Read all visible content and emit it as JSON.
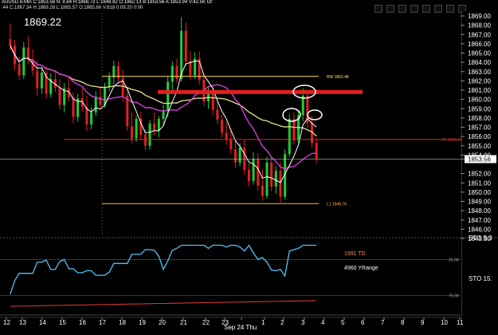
{
  "header": {
    "line1": "AUUSD 8-Min  C:1853.56  N: 8.84  H:1868.73  L:1848.82  O:1862.13  B:1853.56  A:1853.94  V:42.5K  OI:",
    "line2": ":44  C:1867.34  H:1869.28  L:1865.57  O:1865.66  V:618  0:09:20  0:00"
  },
  "current_price_big": "1869.22",
  "chart_data": {
    "type": "candlestick",
    "y_axis": {
      "min": 1845,
      "max": 1869,
      "ticks": [
        "1869.00",
        "1868.00",
        "1867.00",
        "1866.00",
        "1865.00",
        "1864.00",
        "1863.00",
        "1862.00",
        "1861.00",
        "1860.00",
        "1859.00",
        "1858.00",
        "1857.00",
        "1856.00",
        "1855.00",
        "1854.00",
        "1853.56",
        "1852.00",
        "1851.00",
        "1850.00",
        "1849.00",
        "1848.00",
        "1847.00",
        "1846.00",
        "1845.00"
      ]
    },
    "x_axis": {
      "ticks": [
        "12",
        "13",
        "14",
        "15",
        "16",
        "17",
        "18",
        "19",
        "20",
        "21",
        "22",
        "23",
        "Sep 24 Thu",
        "1",
        "2",
        "3",
        "4",
        "5",
        "6",
        "7",
        "8",
        "9",
        "10",
        "11"
      ]
    },
    "last_price_label": "1853.56",
    "horizontal_levels": [
      {
        "label": "RW 1862.48",
        "value": 1862.48,
        "color": "#ffe066"
      },
      {
        "label": "TL 1855.68",
        "value": 1855.68,
        "color": "#c0392b"
      },
      {
        "label": "L1 1848.76",
        "value": 1848.76,
        "color": "#ffb347"
      },
      {
        "label": "",
        "value": 1860.8,
        "color": "#e02020"
      },
      {
        "label": "",
        "value": 1853.56,
        "color": "#dddddd"
      }
    ],
    "candles": [
      {
        "o": 1866.5,
        "h": 1868.2,
        "l": 1865.3,
        "c": 1865.8
      },
      {
        "o": 1865.8,
        "h": 1866.4,
        "l": 1863.2,
        "c": 1863.8
      },
      {
        "o": 1863.8,
        "h": 1864.6,
        "l": 1862.1,
        "c": 1862.6
      },
      {
        "o": 1862.6,
        "h": 1866.2,
        "l": 1862.2,
        "c": 1865.6
      },
      {
        "o": 1865.6,
        "h": 1866.8,
        "l": 1863.8,
        "c": 1864.3
      },
      {
        "o": 1864.3,
        "h": 1865.4,
        "l": 1862.6,
        "c": 1863.1
      },
      {
        "o": 1863.1,
        "h": 1864.2,
        "l": 1860.4,
        "c": 1861.2
      },
      {
        "o": 1861.2,
        "h": 1863.4,
        "l": 1860.6,
        "c": 1862.9
      },
      {
        "o": 1862.9,
        "h": 1863.6,
        "l": 1860.1,
        "c": 1860.6
      },
      {
        "o": 1860.6,
        "h": 1862.8,
        "l": 1860.2,
        "c": 1862.2
      },
      {
        "o": 1862.2,
        "h": 1863.1,
        "l": 1860.8,
        "c": 1861.3
      },
      {
        "o": 1861.3,
        "h": 1862.2,
        "l": 1858.9,
        "c": 1859.4
      },
      {
        "o": 1859.4,
        "h": 1861.8,
        "l": 1858.6,
        "c": 1861.2
      },
      {
        "o": 1861.2,
        "h": 1862.4,
        "l": 1859.8,
        "c": 1860.2
      },
      {
        "o": 1860.2,
        "h": 1860.8,
        "l": 1857.4,
        "c": 1858.1
      },
      {
        "o": 1858.1,
        "h": 1860.6,
        "l": 1857.6,
        "c": 1860.1
      },
      {
        "o": 1860.1,
        "h": 1861.2,
        "l": 1858.7,
        "c": 1859.2
      },
      {
        "o": 1859.2,
        "h": 1860.4,
        "l": 1856.6,
        "c": 1857.3
      },
      {
        "o": 1857.3,
        "h": 1859.2,
        "l": 1856.8,
        "c": 1858.6
      },
      {
        "o": 1858.6,
        "h": 1860.9,
        "l": 1858.2,
        "c": 1860.3
      },
      {
        "o": 1860.3,
        "h": 1861.4,
        "l": 1858.9,
        "c": 1859.4
      },
      {
        "o": 1859.4,
        "h": 1861.8,
        "l": 1859.1,
        "c": 1861.3
      },
      {
        "o": 1861.3,
        "h": 1862.9,
        "l": 1860.9,
        "c": 1862.4
      },
      {
        "o": 1862.4,
        "h": 1864.2,
        "l": 1861.6,
        "c": 1863.6
      },
      {
        "o": 1863.6,
        "h": 1864.1,
        "l": 1861.8,
        "c": 1862.3
      },
      {
        "o": 1862.3,
        "h": 1863.2,
        "l": 1859.7,
        "c": 1860.4
      },
      {
        "o": 1860.4,
        "h": 1861.2,
        "l": 1856.6,
        "c": 1857.1
      },
      {
        "o": 1857.1,
        "h": 1858.6,
        "l": 1855.2,
        "c": 1855.8
      },
      {
        "o": 1855.8,
        "h": 1858.3,
        "l": 1855.4,
        "c": 1857.9
      },
      {
        "o": 1857.9,
        "h": 1858.7,
        "l": 1855.6,
        "c": 1856.2
      },
      {
        "o": 1856.2,
        "h": 1856.8,
        "l": 1854.5,
        "c": 1855.0
      },
      {
        "o": 1855.0,
        "h": 1857.8,
        "l": 1854.6,
        "c": 1857.4
      },
      {
        "o": 1857.4,
        "h": 1858.6,
        "l": 1856.1,
        "c": 1856.6
      },
      {
        "o": 1856.6,
        "h": 1858.2,
        "l": 1855.9,
        "c": 1857.9
      },
      {
        "o": 1857.9,
        "h": 1859.4,
        "l": 1857.2,
        "c": 1858.8
      },
      {
        "o": 1858.8,
        "h": 1862.5,
        "l": 1858.1,
        "c": 1861.9
      },
      {
        "o": 1861.9,
        "h": 1864.1,
        "l": 1860.6,
        "c": 1863.6
      },
      {
        "o": 1863.6,
        "h": 1864.4,
        "l": 1861.8,
        "c": 1862.2
      },
      {
        "o": 1862.2,
        "h": 1868.9,
        "l": 1861.9,
        "c": 1867.4
      },
      {
        "o": 1867.4,
        "h": 1868.3,
        "l": 1863.6,
        "c": 1864.1
      },
      {
        "o": 1864.1,
        "h": 1865.2,
        "l": 1862.1,
        "c": 1862.6
      },
      {
        "o": 1862.6,
        "h": 1865.1,
        "l": 1862.2,
        "c": 1864.4
      },
      {
        "o": 1864.4,
        "h": 1865.2,
        "l": 1861.6,
        "c": 1862.1
      },
      {
        "o": 1862.1,
        "h": 1862.7,
        "l": 1859.3,
        "c": 1859.8
      },
      {
        "o": 1859.8,
        "h": 1861.3,
        "l": 1859.0,
        "c": 1860.7
      },
      {
        "o": 1860.7,
        "h": 1861.4,
        "l": 1858.3,
        "c": 1858.9
      },
      {
        "o": 1858.9,
        "h": 1859.8,
        "l": 1857.4,
        "c": 1857.8
      },
      {
        "o": 1857.8,
        "h": 1858.4,
        "l": 1855.9,
        "c": 1856.4
      },
      {
        "o": 1856.4,
        "h": 1857.6,
        "l": 1855.1,
        "c": 1855.7
      },
      {
        "o": 1855.7,
        "h": 1856.9,
        "l": 1854.1,
        "c": 1854.6
      },
      {
        "o": 1854.6,
        "h": 1855.7,
        "l": 1852.6,
        "c": 1853.2
      },
      {
        "o": 1853.2,
        "h": 1855.3,
        "l": 1852.8,
        "c": 1854.8
      },
      {
        "o": 1854.8,
        "h": 1855.6,
        "l": 1851.9,
        "c": 1852.4
      },
      {
        "o": 1852.4,
        "h": 1853.1,
        "l": 1850.6,
        "c": 1851.2
      },
      {
        "o": 1851.2,
        "h": 1854.3,
        "l": 1850.8,
        "c": 1853.6
      },
      {
        "o": 1853.6,
        "h": 1854.2,
        "l": 1850.2,
        "c": 1850.7
      },
      {
        "o": 1850.7,
        "h": 1852.4,
        "l": 1849.1,
        "c": 1849.6
      },
      {
        "o": 1849.6,
        "h": 1853.8,
        "l": 1849.3,
        "c": 1853.2
      },
      {
        "o": 1853.2,
        "h": 1853.9,
        "l": 1850.1,
        "c": 1850.6
      },
      {
        "o": 1850.6,
        "h": 1852.8,
        "l": 1849.8,
        "c": 1852.3
      },
      {
        "o": 1852.3,
        "h": 1853.2,
        "l": 1848.9,
        "c": 1849.5
      },
      {
        "o": 1849.5,
        "h": 1854.6,
        "l": 1849.2,
        "c": 1854.1
      },
      {
        "o": 1854.1,
        "h": 1858.4,
        "l": 1853.8,
        "c": 1857.9
      },
      {
        "o": 1857.9,
        "h": 1858.6,
        "l": 1855.1,
        "c": 1855.6
      },
      {
        "o": 1855.6,
        "h": 1858.8,
        "l": 1855.2,
        "c": 1858.3
      },
      {
        "o": 1858.3,
        "h": 1861.2,
        "l": 1857.6,
        "c": 1860.4
      },
      {
        "o": 1860.4,
        "h": 1860.9,
        "l": 1856.9,
        "c": 1857.5
      },
      {
        "o": 1857.5,
        "h": 1858.2,
        "l": 1854.8,
        "c": 1855.3
      },
      {
        "o": 1855.3,
        "h": 1855.8,
        "l": 1853.1,
        "c": 1853.6
      }
    ],
    "indicator_lines": [
      {
        "name": "",
        "color": "#e8e090"
      },
      {
        "name": "",
        "color": "#e040e0"
      },
      {
        "name": "",
        "color": "#ffffff"
      }
    ],
    "oscillator_panel": {
      "labels": [
        "1991 TD",
        "4960 YRange"
      ],
      "axis_labels": [
        "STO",
        "STO",
        "25.00",
        "75.00"
      ],
      "axis_values": [
        "9.3",
        "15."
      ],
      "lines": [
        {
          "name": "",
          "color": "#4fc3f7"
        },
        {
          "name": "",
          "color": "#e53935"
        }
      ]
    }
  }
}
